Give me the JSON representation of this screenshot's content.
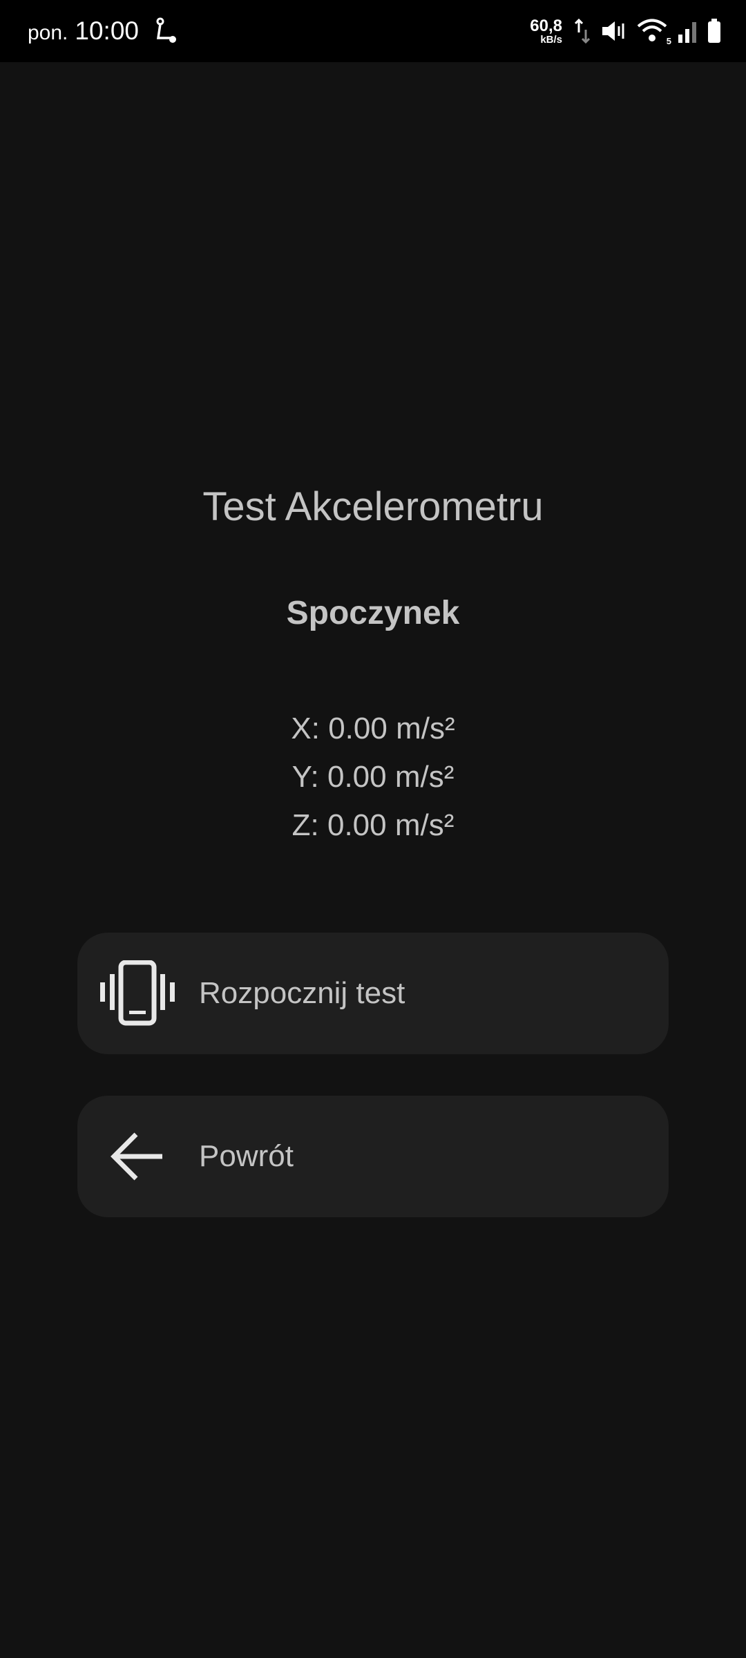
{
  "status_bar": {
    "day": "pon.",
    "time": "10:00",
    "network_speed": "60,8",
    "network_speed_unit": "kB/s",
    "wifi_badge": "5"
  },
  "screen": {
    "title": "Test Akcelerometru",
    "state": "Spoczynek",
    "readings": {
      "x": "X: 0.00 m/s²",
      "y": "Y: 0.00 m/s²",
      "z": "Z: 0.00 m/s²"
    }
  },
  "buttons": {
    "start": {
      "label": "Rozpocznij test",
      "icon": "vibrate-phone-icon"
    },
    "back": {
      "label": "Powrót",
      "icon": "arrow-left-icon"
    }
  },
  "colors": {
    "background": "#121212",
    "status_bar": "#000000",
    "button_bg": "#1f1f1f",
    "text": "#c4c4c4",
    "icon": "#e8e8e8"
  }
}
